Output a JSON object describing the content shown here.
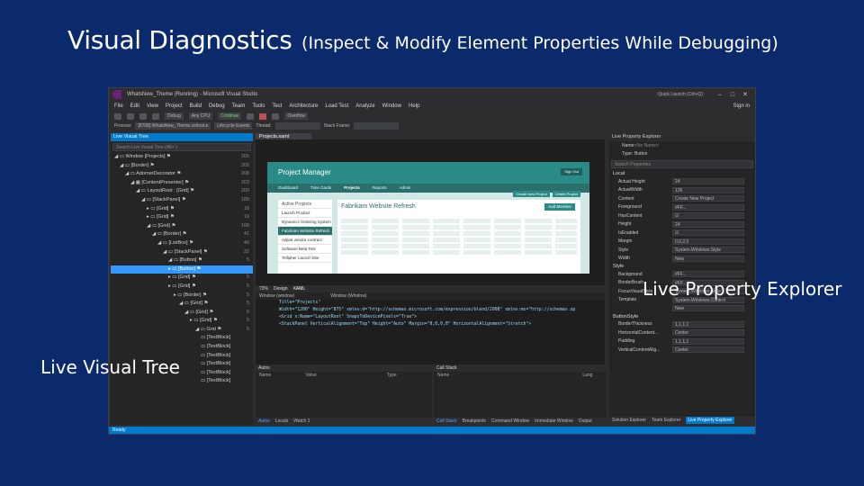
{
  "slide": {
    "title_main": "Visual Diagnostics",
    "title_sub": "(Inspect & Modify Element Properties While Debugging)",
    "callout_left": "Live Visual Tree",
    "callout_right": "Live Property Explorer"
  },
  "window": {
    "title": "WhatsNew_Theme (Running) - Microsoft Visual Studio",
    "quick_launch": "Quick Launch (Ctrl+Q)",
    "sign_in": "Sign in"
  },
  "menu": [
    "File",
    "Edit",
    "View",
    "Project",
    "Build",
    "Debug",
    "Team",
    "Tools",
    "Test",
    "Architecture",
    "Load Test",
    "Analyze",
    "Window",
    "Help"
  ],
  "toolbar": {
    "config": "Debug",
    "platform": "Any CPU",
    "continue": "Continue",
    "solution": "Overflow"
  },
  "procbar": {
    "label": "Process:",
    "process": "[8708] WhatsNew_Theme.vshost.e",
    "lifecycle": "Lifecycle Events",
    "thread": "Thread:",
    "stack": "Stack Frame:"
  },
  "lvt": {
    "title": "Live Visual Tree",
    "search": "Search Live Visual Tree (Alt+`)",
    "rows": [
      {
        "label": "◢ ▭ Window [Projects] ⚑",
        "count": "265"
      },
      {
        "label": "◢ ▭ [Border] ⚑",
        "count": "209"
      },
      {
        "label": "◢ ▭ AdornerDecorator ⚑",
        "count": "208"
      },
      {
        "label": "◢ ▦ [ContentPresenter] ⚑",
        "count": "203"
      },
      {
        "label": "◢ ▭ LayoutRoot : [Grid] ⚑",
        "count": "200"
      },
      {
        "label": "◢ ▭ [StackPanel] ⚑",
        "count": "189"
      },
      {
        "label": "▸ ▭ [Grid] ⚑",
        "count": "18"
      },
      {
        "label": "▸ ▭ [Grid] ⚑",
        "count": "19"
      },
      {
        "label": "◢ ▭ [Grid] ⚑",
        "count": "168"
      },
      {
        "label": "◢ ▭ [Border] ⚑",
        "count": "41"
      },
      {
        "label": "◢ ▭ [ListBox] ⚑",
        "count": "40"
      },
      {
        "label": "◢ ▭ [StackPanel] ⚑",
        "count": "32"
      },
      {
        "label": "◢ ▭ [Button] ⚑",
        "count": "5"
      },
      {
        "label": "▸ ▭ [Button] ⚑",
        "count": "5"
      },
      {
        "label": "▸ ▭ [Grid] ⚑",
        "count": "5"
      },
      {
        "label": "▸ ▭ [Grid] ⚑",
        "count": "5"
      },
      {
        "label": "▸ ▭ [Border] ⚑",
        "count": "5"
      },
      {
        "label": "◢ ▭ [Grid] ⚑",
        "count": "5"
      },
      {
        "label": "◢ ▭ [Grid] ⚑",
        "count": "5"
      },
      {
        "label": "▸ ▭ [Grid] ⚑",
        "count": "5"
      },
      {
        "label": "◢ ▭ Grid ⚑",
        "count": "5"
      },
      {
        "label": "▭ [TextBlock]",
        "count": ""
      },
      {
        "label": "▭ [TextBlock]",
        "count": ""
      },
      {
        "label": "▭ [TextBlock]",
        "count": ""
      },
      {
        "label": "▭ [TextBlock]",
        "count": ""
      },
      {
        "label": "▭ [TextBlock]",
        "count": ""
      },
      {
        "label": "▭ [TextBlock]",
        "count": ""
      }
    ],
    "selected_index": 13
  },
  "designer": {
    "tab": "Projects.xaml",
    "app_title": "Project Manager",
    "sign_out": "Sign Out",
    "nav": [
      "Dashboard",
      "Time Cards",
      "Projects",
      "Reports",
      "Admin"
    ],
    "sidebar_header": "Active Projects",
    "sidebar_items": [
      "Launch Product",
      "Dynamics Ordering System",
      "Fabrikam Website Refresh",
      "Adjust vendor contract",
      "Software Beta Test",
      "Tellipher Launch bbe"
    ],
    "sidebar_selected": 2,
    "content_title": "Fabrikam Website Refresh",
    "add_button": "Add Member",
    "create_button": "Create New Project",
    "delete_button": "Delete Project"
  },
  "xaml": {
    "tabs": [
      "Design",
      "XAML"
    ],
    "zoom": "73%",
    "path_left": "Window (window)",
    "path_right": "Window (Window)",
    "lines": [
      "Title=\"Projects\"",
      "Width=\"1200\" Height=\"875\" xmlns:d=\"http://schemas.microsoft.com/expression/blend/2008\" xmlns:mc=\"http://schemas.op",
      "",
      "<Grid x:Name=\"LayoutRoot\" SnapsToDevicePixels=\"True\">",
      "  <StackPanel VerticalAlignment=\"Top\" Height=\"Auto\" Margin=\"0,0,0,0\" HorizontalAlignment=\"Stretch\">"
    ]
  },
  "autos": {
    "title": "Autos",
    "cols": [
      "Name",
      "Value",
      "Type"
    ],
    "tabs": [
      "Autos",
      "Locals",
      "Watch 1"
    ]
  },
  "callstack": {
    "title": "Call Stack",
    "cols": [
      "Name",
      "Lang"
    ],
    "tabs": [
      "Call Stack",
      "Breakpoints",
      "Command Window",
      "Immediate Window",
      "Output"
    ]
  },
  "lpe": {
    "title": "Live Property Explorer",
    "name_label": "Name:",
    "name_value": "<No Name>",
    "type_label": "Type:",
    "type_value": "Button",
    "search": "Search Properties",
    "groups": {
      "local": "Local",
      "style": "Style",
      "button_style": "ButtonStyle"
    },
    "local_rows": [
      {
        "n": "Actual Height",
        "v": "24"
      },
      {
        "n": "ActualWidth",
        "v": "126"
      },
      {
        "n": "Content",
        "v": "Create New Project"
      },
      {
        "n": "Foreground",
        "v": "#FF..."
      },
      {
        "n": "HasContent",
        "v": "☑"
      },
      {
        "n": "Height",
        "v": "24"
      },
      {
        "n": "IsEnabled",
        "v": "☑"
      },
      {
        "n": "Margin",
        "v": "0,0,2,0"
      },
      {
        "n": "Style",
        "v": "System.Windows.Style"
      },
      {
        "n": "Width",
        "v": "New"
      }
    ],
    "style_rows": [
      {
        "n": "Background",
        "v": "#FF..."
      },
      {
        "n": "BorderBrush",
        "v": "#FF..."
      },
      {
        "n": "FocusVisualStyle",
        "v": "System.Windows.Style"
      },
      {
        "n": "Template",
        "v": "System.Windows.Control"
      },
      {
        "n": "",
        "v": "New"
      }
    ],
    "button_rows": [
      {
        "n": "BorderThickness",
        "v": "1,1,1,1"
      },
      {
        "n": "HorizontalContent...",
        "v": "Center"
      },
      {
        "n": "Padding",
        "v": "1,1,1,1"
      },
      {
        "n": "VerticalContentAlig...",
        "v": "Center"
      }
    ],
    "bottom_tabs": [
      "Solution Explorer",
      "Team Explorer",
      "Live Property Explorer"
    ]
  },
  "status": "Ready"
}
